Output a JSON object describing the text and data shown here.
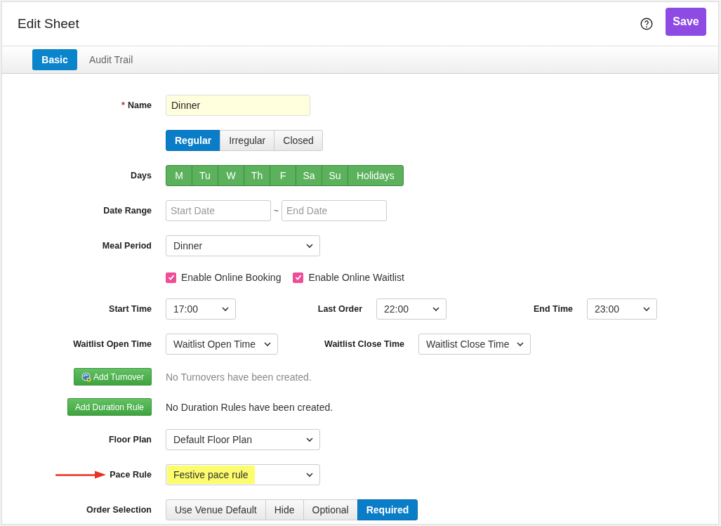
{
  "header": {
    "title": "Edit Sheet",
    "save_label": "Save"
  },
  "tabs": [
    {
      "label": "Basic",
      "selected": true
    },
    {
      "label": "Audit Trail",
      "selected": false
    }
  ],
  "rows": [
    {
      "kind": "text-field",
      "label": "Name",
      "required_mark": "*",
      "value": "Dinner"
    },
    {
      "kind": "segmented",
      "options": [
        {
          "label": "Regular",
          "selected": true
        },
        {
          "label": "Irregular",
          "selected": false
        },
        {
          "label": "Closed",
          "selected": false
        }
      ]
    },
    {
      "kind": "days",
      "label": "Days",
      "days": [
        {
          "label": "M",
          "selected": true
        },
        {
          "label": "Tu",
          "selected": true
        },
        {
          "label": "W",
          "selected": true
        },
        {
          "label": "Th",
          "selected": true
        },
        {
          "label": "F",
          "selected": true
        },
        {
          "label": "Sa",
          "selected": true
        },
        {
          "label": "Su",
          "selected": true
        },
        {
          "label": "Holidays",
          "selected": true
        }
      ]
    },
    {
      "kind": "date-range",
      "label": "Date Range",
      "start_placeholder": "Start Date",
      "separator": "~",
      "end_placeholder": "End Date"
    },
    {
      "kind": "select",
      "pairs": [
        {
          "label": "Meal Period",
          "value": "Dinner"
        }
      ]
    },
    {
      "kind": "checkboxes",
      "items": [
        {
          "label": "Enable Online Booking",
          "checked": true
        },
        {
          "label": "Enable Online Waitlist",
          "checked": true
        }
      ]
    },
    {
      "kind": "time-selects",
      "pairs": [
        {
          "label": "Start Time",
          "value": "17:00"
        },
        {
          "label": "Last Order",
          "value": "22:00"
        },
        {
          "label": "End Time",
          "value": "23:00"
        }
      ]
    },
    {
      "kind": "waitlist-selects",
      "pairs": [
        {
          "label": "Waitlist Open Time",
          "value": "Waitlist Open Time"
        },
        {
          "label": "Waitlist Close Time",
          "value": "Waitlist Close Time"
        }
      ]
    },
    {
      "kind": "action",
      "button": "Add Turnover",
      "icon": true,
      "message": "No Turnovers have been created.",
      "muted": true
    },
    {
      "kind": "action",
      "button": "Add Duration Rule",
      "icon": false,
      "message": "No Duration Rules have been created.",
      "muted": false
    },
    {
      "kind": "select",
      "pairs": [
        {
          "label": "Floor Plan",
          "value": "Default Floor Plan"
        }
      ]
    },
    {
      "kind": "select",
      "arrow": true,
      "pairs": [
        {
          "label": "Pace Rule",
          "value": "Festive pace rule",
          "highlighted": true
        }
      ]
    },
    {
      "kind": "segmented",
      "label": "Order Selection",
      "options": [
        {
          "label": "Use Venue Default",
          "selected": false
        },
        {
          "label": "Hide",
          "selected": false
        },
        {
          "label": "Optional",
          "selected": false
        },
        {
          "label": "Required",
          "selected": true
        }
      ]
    }
  ]
}
